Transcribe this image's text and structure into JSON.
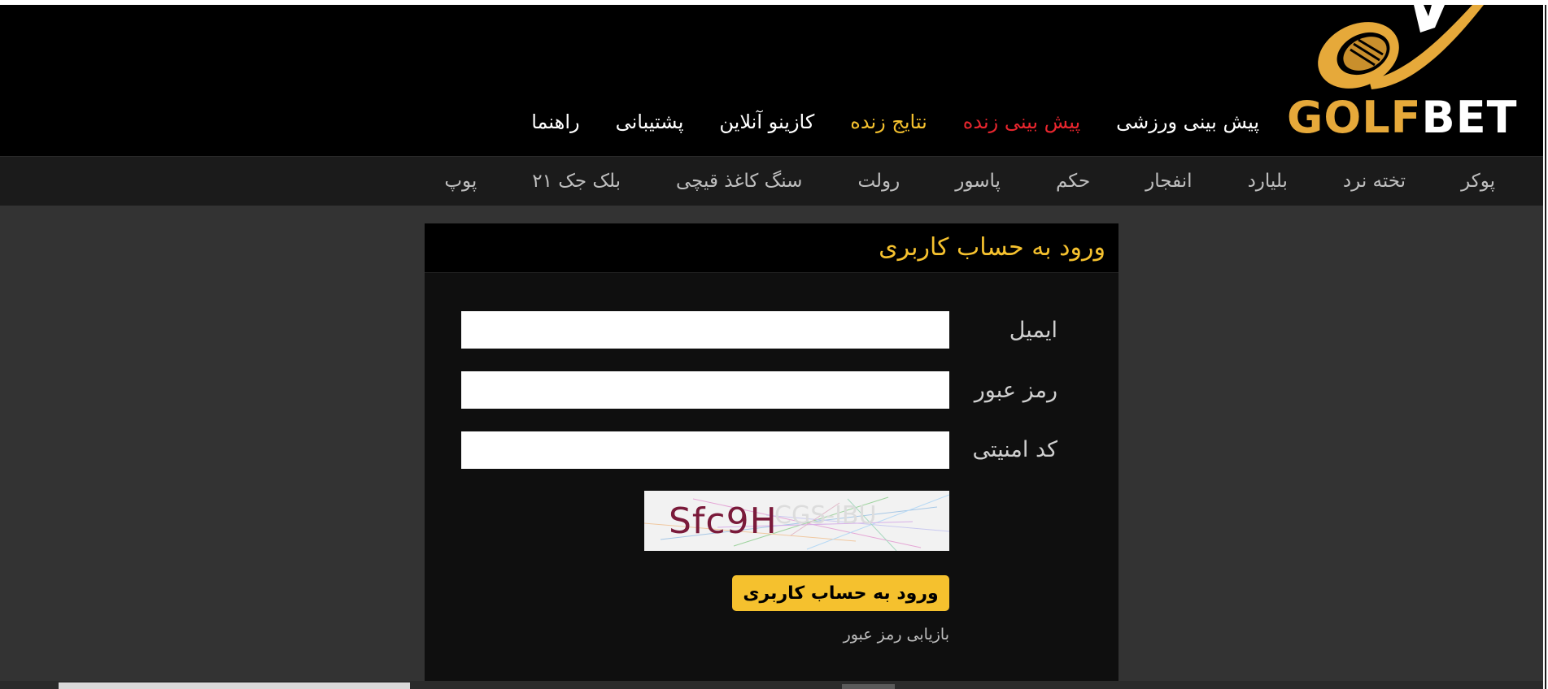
{
  "colors": {
    "accent": "#f5c12e",
    "live_red": "#e8262e",
    "logo_gold": "#e6a93a"
  },
  "logo": {
    "golf": "GOLF",
    "bet": "BET",
    "icon": "golf-club-icon"
  },
  "main_nav": [
    {
      "label": "پیش بینی ورزشی",
      "color": "white"
    },
    {
      "label": "پیش بینی زنده",
      "color": "red"
    },
    {
      "label": "نتایج زنده",
      "color": "yellow"
    },
    {
      "label": "کازینو آنلاین",
      "color": "white"
    },
    {
      "label": "پشتیبانی",
      "color": "white"
    },
    {
      "label": "راهنما",
      "color": "white"
    }
  ],
  "sub_nav": [
    "پوکر",
    "تخته نرد",
    "بلیارد",
    "انفجار",
    "حکم",
    "پاسور",
    "رولت",
    "سنگ کاغذ قیچی",
    "بلک جک ۲۱",
    "پوپ"
  ],
  "login": {
    "title": "ورود به حساب کاربری",
    "email_label": "ایمیل",
    "password_label": "رمز عبور",
    "captcha_label": "کد امنیتی",
    "captcha_text": "Sfc9H",
    "submit_label": "ورود به حساب کاربری",
    "forgot_label": "بازیابی رمز عبور"
  }
}
